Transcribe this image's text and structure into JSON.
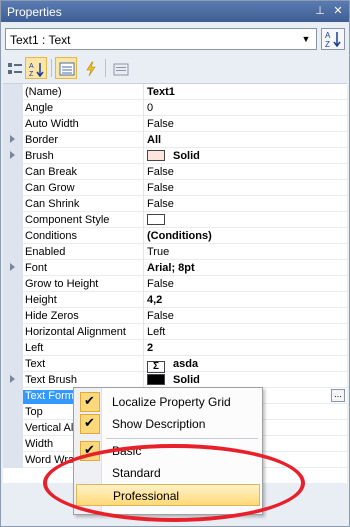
{
  "window": {
    "title": "Properties",
    "pin_glyph": "⊥",
    "close_glyph": "✕"
  },
  "object_selector": {
    "value": "Text1 : Text",
    "arrow": "▼"
  },
  "toolbar": {
    "buttons": [
      {
        "icon": "categorized-icon",
        "active": false
      },
      {
        "icon": "alphabetical-sort-icon",
        "active": true
      },
      {
        "icon": "properties-icon",
        "active": true
      },
      {
        "icon": "events-lightning-icon",
        "active": false
      },
      {
        "icon": "property-pages-icon",
        "active": false
      }
    ]
  },
  "properties": [
    {
      "name": "(Name)",
      "value": "Text1",
      "bold": true,
      "expandable": false
    },
    {
      "name": "Angle",
      "value": "0",
      "bold": false,
      "expandable": false
    },
    {
      "name": "Auto Width",
      "value": "False",
      "bold": false,
      "expandable": false
    },
    {
      "name": "Border",
      "value": "All",
      "bold": true,
      "expandable": true
    },
    {
      "name": "Brush",
      "value": "Solid",
      "bold": true,
      "expandable": true,
      "swatch": "#fbe5dc"
    },
    {
      "name": "Can Break",
      "value": "False",
      "bold": false,
      "expandable": false
    },
    {
      "name": "Can Grow",
      "value": "False",
      "bold": false,
      "expandable": false
    },
    {
      "name": "Can Shrink",
      "value": "False",
      "bold": false,
      "expandable": false
    },
    {
      "name": "Component Style",
      "value": "",
      "bold": false,
      "expandable": false,
      "swatch": "#ffffff"
    },
    {
      "name": "Conditions",
      "value": "(Conditions)",
      "bold": true,
      "expandable": false
    },
    {
      "name": "Enabled",
      "value": "True",
      "bold": false,
      "expandable": false
    },
    {
      "name": "Font",
      "value": "Arial; 8pt",
      "bold": true,
      "expandable": true
    },
    {
      "name": "Grow to Height",
      "value": "False",
      "bold": false,
      "expandable": false
    },
    {
      "name": "Height",
      "value": "4,2",
      "bold": true,
      "expandable": false
    },
    {
      "name": "Hide Zeros",
      "value": "False",
      "bold": false,
      "expandable": false
    },
    {
      "name": "Horizontal Alignment",
      "value": "Left",
      "bold": false,
      "expandable": false
    },
    {
      "name": "Left",
      "value": "2",
      "bold": true,
      "expandable": false
    },
    {
      "name": "Text",
      "value": "asda",
      "bold": true,
      "expandable": false,
      "sigma": "Σ"
    },
    {
      "name": "Text Brush",
      "value": "Solid",
      "bold": true,
      "expandable": true,
      "swatch": "#000000"
    },
    {
      "name": "Text Format",
      "value": "",
      "bold": false,
      "expandable": false,
      "selected": true,
      "ellipsis": "..."
    },
    {
      "name": "Top",
      "value": "",
      "bold": false,
      "expandable": false
    },
    {
      "name": "Vertical Alignment",
      "value": "",
      "bold": false,
      "expandable": false
    },
    {
      "name": "Width",
      "value": "",
      "bold": false,
      "expandable": false
    },
    {
      "name": "Word Wrap",
      "value": "",
      "bold": false,
      "expandable": false
    }
  ],
  "context_menu": {
    "items": [
      {
        "label": "Localize Property Grid",
        "checked": true
      },
      {
        "label": "Show Description",
        "checked": true
      },
      {
        "label": "Basic",
        "checked": true
      },
      {
        "label": "Standard",
        "checked": false
      },
      {
        "label": "Professional",
        "checked": false,
        "hover": true
      }
    ],
    "check_glyph": "✔"
  },
  "annotation": {
    "color": "#e8202a"
  }
}
